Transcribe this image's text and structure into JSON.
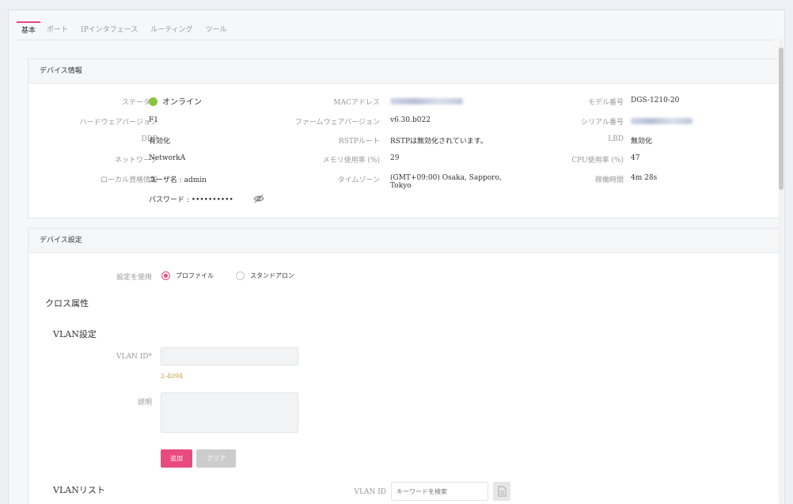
{
  "tabs": [
    "基本",
    "ポート",
    "IPインタフェース",
    "ルーティング",
    "ツール"
  ],
  "device_info": {
    "title": "デバイス情報",
    "status_label": "ステータス",
    "status_value": "オンライン",
    "hw_label": "ハードウェアバージョン",
    "hw_value": "F1",
    "ddp_label": "DDP",
    "ddp_value": "有効化",
    "network_label": "ネットワーク",
    "network_value": "NetworkA",
    "cred_label": "ローカル資格情報",
    "username": "ユーザ名 : admin",
    "password": "パスワード : ••••••••••",
    "mac_label": "MACアドレス",
    "fw_label": "ファームウェアバージョン",
    "fw_value": "v6.30.b022",
    "rstp_label": "RSTPルート",
    "rstp_value": "RSTPは無効化されています。",
    "mem_label": "メモリ使用率 (%)",
    "mem_value": "29",
    "tz_label": "タイムゾーン",
    "tz_value_line1": "(GMT+09:00) Osaka, Sapporo,",
    "tz_value_line2": "Tokyo",
    "model_label": "モデル番号",
    "model_value": "DGS-1210-20",
    "serial_label": "シリアル番号",
    "lbd_label": "LBD",
    "lbd_value": "無効化",
    "cpu_label": "CPU使用率 (%)",
    "cpu_value": "47",
    "uptime_label": "稼働時間",
    "uptime_value": "4m 28s"
  },
  "device_settings": {
    "title": "デバイス設定",
    "use_settings_label": "設定を使用",
    "radio_profile": "プロファイル",
    "radio_standalone": "スタンドアロン",
    "cross_attr": "クロス属性",
    "vlan_settings": "VLAN設定",
    "vlan_id_label": "VLAN ID*",
    "vlan_id_hint": "2-4094",
    "desc_label": "説明",
    "add_button": "追加",
    "clear_button": "クリア",
    "vlan_list": "VLANリスト",
    "vlan_search_label": "VLAN ID",
    "vlan_search_placeholder": "キーワードを検索"
  },
  "colors": {
    "accent": "#e8497e",
    "online": "#8ac43f",
    "hint": "#c9a227",
    "disabled_button": "#cccccc"
  }
}
